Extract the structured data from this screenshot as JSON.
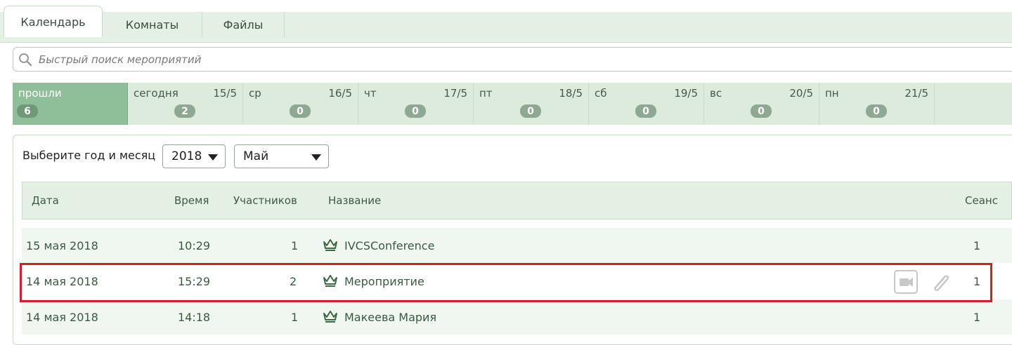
{
  "tabs": [
    {
      "label": "Календарь",
      "active": true
    },
    {
      "label": "Комнаты",
      "active": false
    },
    {
      "label": "Файлы",
      "active": false
    }
  ],
  "search": {
    "placeholder": "Быстрый поиск мероприятий"
  },
  "days": [
    {
      "name": "прошли",
      "date": "",
      "count": "6",
      "past": true
    },
    {
      "name": "сегодня",
      "date": "15/5",
      "count": "2"
    },
    {
      "name": "ср",
      "date": "16/5",
      "count": "0"
    },
    {
      "name": "чт",
      "date": "17/5",
      "count": "0"
    },
    {
      "name": "пт",
      "date": "18/5",
      "count": "0"
    },
    {
      "name": "сб",
      "date": "19/5",
      "count": "0"
    },
    {
      "name": "вс",
      "date": "20/5",
      "count": "0"
    },
    {
      "name": "пн",
      "date": "21/5",
      "count": "0"
    }
  ],
  "selector": {
    "label": "Выберите год и месяц",
    "year": "2018",
    "month": "Май"
  },
  "table": {
    "headers": {
      "date": "Дата",
      "time": "Время",
      "participants": "Участников",
      "name": "Название",
      "session": "Сеанс"
    },
    "rows": [
      {
        "date": "15 мая 2018",
        "time": "10:29",
        "participants": "1",
        "name": "IVCSConference",
        "session": "1"
      },
      {
        "date": "14 мая 2018",
        "time": "15:29",
        "participants": "2",
        "name": "Мероприятие",
        "session": "1"
      },
      {
        "date": "14 мая 2018",
        "time": "14:18",
        "participants": "1",
        "name": "Макеева Мария",
        "session": "1"
      }
    ]
  },
  "colors": {
    "accent": "#8fbf98",
    "header_bg": "#e4f0e4",
    "highlight": "#d21e2b",
    "text": "#3c5a43"
  },
  "icons": [
    "search-icon",
    "crown-icon",
    "video-camera-icon",
    "paperclip-icon",
    "caret-down-icon"
  ]
}
